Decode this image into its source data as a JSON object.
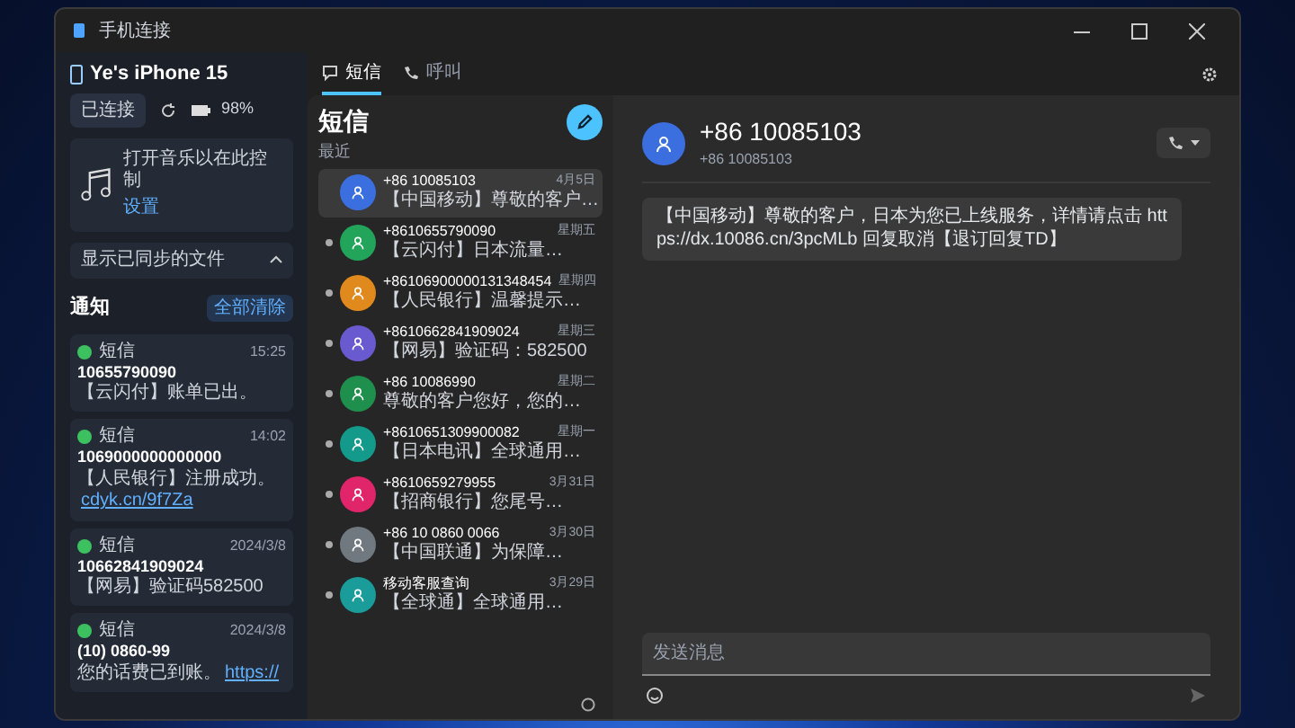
{
  "window": {
    "title": "手机连接"
  },
  "device": {
    "name": "Ye's iPhone 15",
    "status": "已连接",
    "battery": "98%"
  },
  "media_card": {
    "text": "打开音乐以在此控制",
    "link": "设置"
  },
  "banner": {
    "text": "显示已同步的文件"
  },
  "notifications": {
    "title": "通知",
    "clear": "全部清除",
    "items": [
      {
        "app": "短信",
        "time": "15:25",
        "sender": "10655790090",
        "text": "【云闪付】账单已出。"
      },
      {
        "app": "短信",
        "time": "14:02",
        "sender": "1069000000000000",
        "text": "【人民银行】注册成功。",
        "link": "cdyk.cn/9f7Za"
      },
      {
        "app": "短信",
        "time": "2024/3/8",
        "sender": "10662841909024",
        "text": "【网易】验证码582500"
      },
      {
        "app": "短信",
        "time": "2024/3/8",
        "sender": "(10) 0860-99",
        "text": "您的话费已到账。",
        "link": "https://"
      }
    ]
  },
  "tabs": [
    {
      "label": "短信",
      "selected": true
    },
    {
      "label": "呼叫",
      "selected": false
    }
  ],
  "messages": {
    "title": "短信",
    "section": "最近",
    "items": [
      {
        "sender": "+86 10085103",
        "time": "4月5日",
        "preview": "【中国移动】尊敬的客户…",
        "color": "#3b6fe0",
        "selected": true,
        "unread": false
      },
      {
        "sender": "+8610655790090",
        "time": "星期五",
        "preview": "【云闪付】日本流量…",
        "color": "#22a45a",
        "selected": false,
        "unread": true
      },
      {
        "sender": "+86106900000131348454",
        "time": "星期四",
        "preview": "【人民银行】温馨提示…",
        "color": "#e08a1e",
        "selected": false,
        "unread": true
      },
      {
        "sender": "+8610662841909024",
        "time": "星期三",
        "preview": "【网易】验证码：582500",
        "color": "#6a5ad0",
        "selected": false,
        "unread": true
      },
      {
        "sender": "+86 10086990",
        "time": "星期二",
        "preview": "尊敬的客户您好，您的…",
        "color": "#1f8f4e",
        "selected": false,
        "unread": true
      },
      {
        "sender": "+8610651309900082",
        "time": "星期一",
        "preview": "【日本电讯】全球通用…",
        "color": "#139a8a",
        "selected": false,
        "unread": true
      },
      {
        "sender": "+8610659279955",
        "time": "3月31日",
        "preview": "【招商银行】您尾号…",
        "color": "#e0256a",
        "selected": false,
        "unread": true
      },
      {
        "sender": "+86 10 0860 0066",
        "time": "3月30日",
        "preview": "【中国联通】为保障…",
        "color": "#707880",
        "selected": false,
        "unread": true
      },
      {
        "sender": "移动客服查询",
        "time": "3月29日",
        "preview": "【全球通】全球通用…",
        "color": "#1a9c9a",
        "selected": false,
        "unread": true
      }
    ]
  },
  "conversation": {
    "title": "+86 10085103",
    "subtitle": "+86 10085103",
    "bubbles": [
      "【中国移动】尊敬的客户，日本为您已上线服务，详情请点击 https://dx.10086.cn/3pcMLb 回复取消【退订回复TD】"
    ],
    "input": {
      "placeholder": "发送消息"
    }
  }
}
